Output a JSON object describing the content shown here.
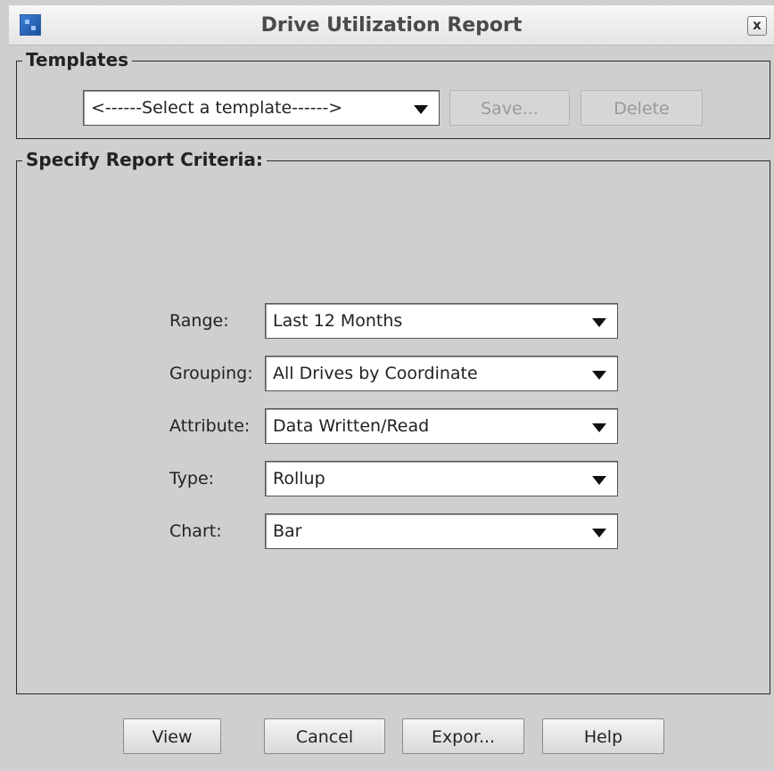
{
  "window": {
    "title": "Drive Utilization Report",
    "icon": "app-icon",
    "close_label": "x"
  },
  "templates": {
    "legend": "Templates",
    "select_value": "<------Select a template------>",
    "save_label": "Save...",
    "delete_label": "Delete"
  },
  "criteria": {
    "legend": "Specify Report Criteria:",
    "fields": [
      {
        "label": "Range:",
        "value": "Last 12 Months"
      },
      {
        "label": "Grouping:",
        "value": "All Drives by Coordinate"
      },
      {
        "label": "Attribute:",
        "value": "Data Written/Read"
      },
      {
        "label": "Type:",
        "value": "Rollup"
      },
      {
        "label": "Chart:",
        "value": "Bar"
      }
    ]
  },
  "buttons": {
    "view": "View",
    "cancel": "Cancel",
    "export": "Expor...",
    "help": "Help"
  }
}
